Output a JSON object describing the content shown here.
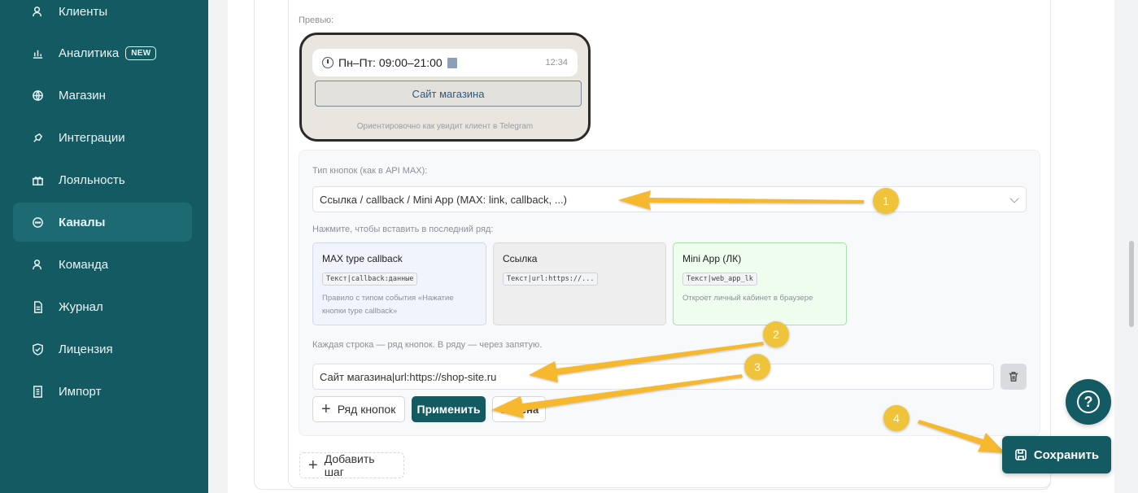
{
  "sidebar": {
    "items": [
      {
        "label": "Клиенты",
        "icon": "users-icon"
      },
      {
        "label": "Аналитика",
        "icon": "bar-chart-icon",
        "badge": "NEW"
      },
      {
        "label": "Магазин",
        "icon": "globe-icon"
      },
      {
        "label": "Интеграции",
        "icon": "plug-icon"
      },
      {
        "label": "Лояльность",
        "icon": "gift-icon"
      },
      {
        "label": "Каналы",
        "icon": "chat-icon",
        "active": true
      },
      {
        "label": "Команда",
        "icon": "team-icon"
      },
      {
        "label": "Журнал",
        "icon": "journal-icon"
      },
      {
        "label": "Лицензия",
        "icon": "shield-icon"
      },
      {
        "label": "Импорт",
        "icon": "import-icon"
      }
    ]
  },
  "preview": {
    "label": "Превью:",
    "message_text": "Пн–Пт: 09:00–21:00",
    "message_time": "12:34",
    "button_label": "Сайт магазина",
    "caption": "Ориентировочно как увидит клиент в Telegram"
  },
  "buttons_config": {
    "type_label": "Тип кнопок (как в API MAX):",
    "type_value": "Ссылка / callback / Mini App (MAX: link, callback, ...)",
    "insert_hint": "Нажмите, чтобы вставить в последний ряд:",
    "tiles": [
      {
        "title": "MAX type callback",
        "code": "Текст|callback:данные",
        "desc": "Правило с типом события «Нажатие кнопки type callback»"
      },
      {
        "title": "Ссылка",
        "code": "Текст|url:https://...",
        "desc": ""
      },
      {
        "title": "Mini App (ЛК)",
        "code": "Текст|web_app_lk",
        "desc": "Откроет личный кабинет в браузере"
      }
    ],
    "rows_hint": "Каждая строка — ряд кнопок. В ряду — через запятую.",
    "row_value": "Сайт магазина|url:https://shop-site.ru",
    "add_row_label": "Ряд кнопок",
    "apply_label": "Применить",
    "cancel_label": "Отмена"
  },
  "add_step_label": "Добавить шаг",
  "save_label": "Сохранить",
  "markers": [
    "1",
    "2",
    "3",
    "4"
  ],
  "colors": {
    "brand": "#135a63",
    "marker": "#f0c43a",
    "arrow": "#f5b82e"
  }
}
